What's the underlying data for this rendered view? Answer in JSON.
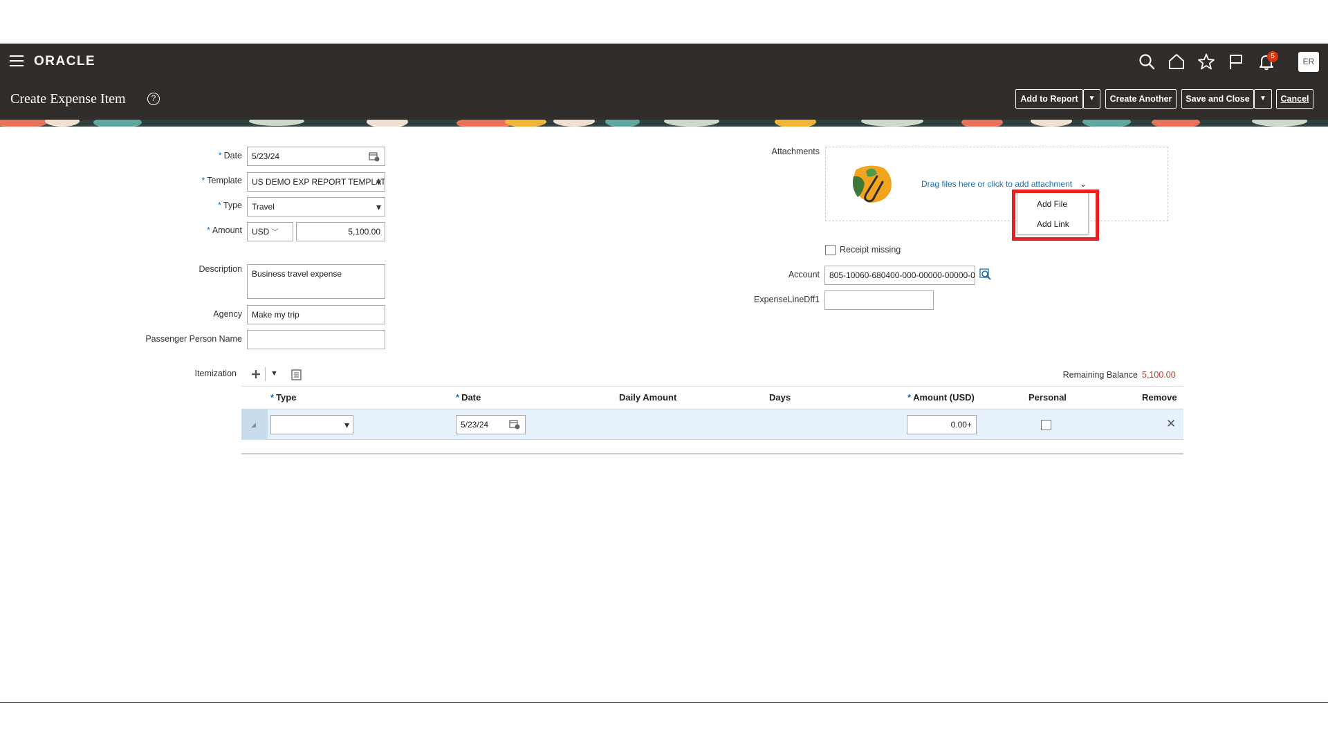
{
  "header": {
    "logo": "ORACLE",
    "notification_count": "5",
    "avatar_initials": "ER"
  },
  "title_bar": {
    "title": "Create Expense Item",
    "help_glyph": "?",
    "buttons": {
      "add_to_report": "Add to Report",
      "create_another": "Create Another",
      "save_and_close": "Save and Close",
      "cancel": "Cancel"
    }
  },
  "form": {
    "date": {
      "label": "Date",
      "value": "5/23/24"
    },
    "template": {
      "label": "Template",
      "value": "US DEMO EXP REPORT TEMPLATE"
    },
    "type": {
      "label": "Type",
      "value": "Travel"
    },
    "amount": {
      "label": "Amount",
      "currency": "USD",
      "value": "5,100.00"
    },
    "description": {
      "label": "Description",
      "value": "Business travel expense"
    },
    "agency": {
      "label": "Agency",
      "value": "Make my trip"
    },
    "passenger": {
      "label": "Passenger Person Name",
      "value": ""
    }
  },
  "attachments": {
    "label": "Attachments",
    "drag_text": "Drag files here or click to add attachment",
    "menu": [
      "Add File",
      "Add Link"
    ]
  },
  "right_fields": {
    "receipt_missing": "Receipt missing",
    "account": {
      "label": "Account",
      "value": "805-10060-680400-000-00000-00000-0"
    },
    "expense_line_dff1": {
      "label": "ExpenseLineDff1",
      "value": ""
    }
  },
  "itemization": {
    "label": "Itemization",
    "remaining_balance_label": "Remaining Balance",
    "remaining_balance_value": "5,100.00",
    "columns": [
      "Type",
      "Date",
      "Daily Amount",
      "Days",
      "Amount (USD)",
      "Personal",
      "Remove"
    ],
    "row": {
      "type": "",
      "date": "5/23/24",
      "amount": "0.00+"
    }
  },
  "colors": {
    "header_bg": "#312d2a",
    "link_blue": "#1a6fb3",
    "highlight_red": "#e62020",
    "balance_red": "#c0392b"
  }
}
